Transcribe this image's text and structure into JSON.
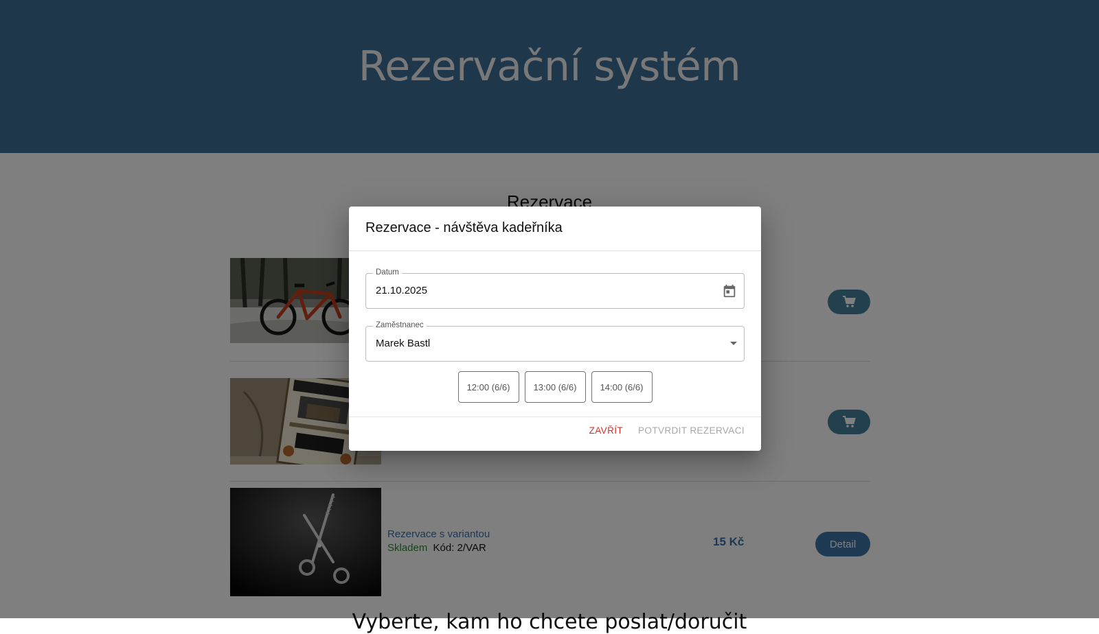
{
  "header": {
    "title": "Rezervační systém"
  },
  "main": {
    "section_title": "Rezervace",
    "products": [
      {
        "type": "bike",
        "action": "cart"
      },
      {
        "type": "poster",
        "action": "cart"
      },
      {
        "type": "scissors",
        "name": "Rezervace s variantou",
        "stock": "Skladem",
        "code": "Kód: 2/VAR",
        "price": "15 Kč",
        "detail_label": "Detail"
      }
    ],
    "footer_heading": "Vyberte, kam ho chcete poslat/doručit"
  },
  "dialog": {
    "title": "Rezervace - návštěva kadeřníka",
    "date": {
      "label": "Datum",
      "value": "21.10.2025"
    },
    "employee": {
      "label": "Zaměstnanec",
      "value": "Marek Bastl"
    },
    "slots": [
      "12:00 (6/6)",
      "13:00 (6/6)",
      "14:00 (6/6)"
    ],
    "close_label": "ZAVŘÍT",
    "confirm_label": "POTVRDIT REZERVACI"
  },
  "colors": {
    "header_bg": "#3f6e96",
    "accent": "#3b6fa8",
    "cart_button": "#46809e",
    "stock_green": "#2e8b2e",
    "close_red": "#d32f2f"
  },
  "icons": {
    "cart": "cart-icon",
    "calendar": "calendar-icon",
    "dropdown": "chevron-down-icon"
  }
}
